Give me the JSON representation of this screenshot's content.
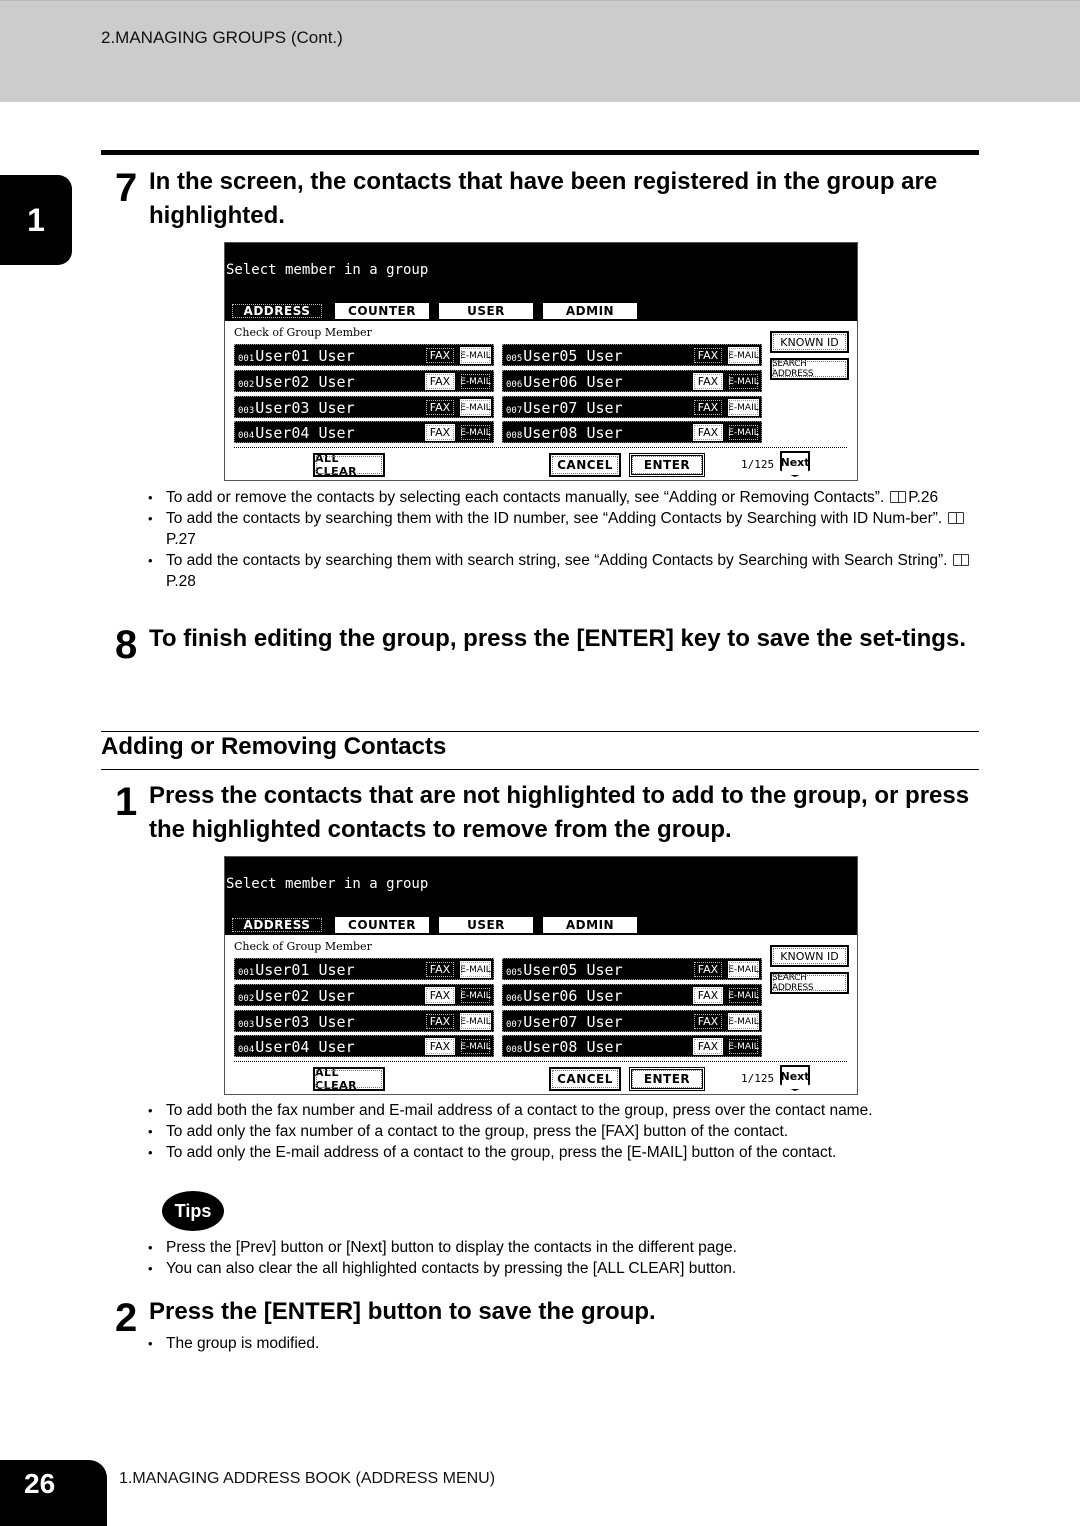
{
  "header": {
    "title": "2.MANAGING GROUPS (Cont.)"
  },
  "side_tab": {
    "chapter": "1"
  },
  "step7": {
    "number": "7",
    "text": "In the screen, the contacts that have been registered in the group are highlighted."
  },
  "screen": {
    "title": "Select member in a group",
    "tabs": [
      {
        "label": "ADDRESS",
        "active": true
      },
      {
        "label": "COUNTER",
        "active": false
      },
      {
        "label": "USER",
        "active": false
      },
      {
        "label": "ADMIN",
        "active": false
      }
    ],
    "check_label": "Check of Group Member",
    "contacts": [
      {
        "id": "001",
        "name": "User01 User",
        "fax_label": "FAX",
        "email_label": "E-MAIL",
        "fax_on": true,
        "email_on": false
      },
      {
        "id": "002",
        "name": "User02 User",
        "fax_label": "FAX",
        "email_label": "E-MAIL",
        "fax_on": false,
        "email_on": true
      },
      {
        "id": "003",
        "name": "User03 User",
        "fax_label": "FAX",
        "email_label": "E-MAIL",
        "fax_on": true,
        "email_on": false
      },
      {
        "id": "004",
        "name": "User04 User",
        "fax_label": "FAX",
        "email_label": "E-MAIL",
        "fax_on": false,
        "email_on": true
      },
      {
        "id": "005",
        "name": "User05 User",
        "fax_label": "FAX",
        "email_label": "E-MAIL",
        "fax_on": true,
        "email_on": false
      },
      {
        "id": "006",
        "name": "User06 User",
        "fax_label": "FAX",
        "email_label": "E-MAIL",
        "fax_on": false,
        "email_on": true
      },
      {
        "id": "007",
        "name": "User07 User",
        "fax_label": "FAX",
        "email_label": "E-MAIL",
        "fax_on": true,
        "email_on": false
      },
      {
        "id": "008",
        "name": "User08 User",
        "fax_label": "FAX",
        "email_label": "E-MAIL",
        "fax_on": false,
        "email_on": true
      }
    ],
    "known_id_label": "KNOWN ID",
    "search_address_label": "SEARCH ADDRESS",
    "all_clear_label": "ALL CLEAR",
    "cancel_label": "CANCEL",
    "enter_label": "ENTER",
    "page_indicator": "1/125",
    "next_label": "Next"
  },
  "step7_bullets": [
    {
      "text": "To add or remove the contacts by selecting each contacts manually, see “Adding or Removing Contacts”.",
      "ref": "P.26"
    },
    {
      "text": "To add the contacts by searching them with the ID number, see “Adding Contacts by Searching with ID Num-ber”.",
      "ref": "P.27"
    },
    {
      "text": "To add the contacts by searching them with search string, see “Adding Contacts by Searching with Search String”.",
      "ref": "P.28"
    }
  ],
  "step8": {
    "number": "8",
    "text": "To finish editing the group, press the [ENTER] key to save the set-tings."
  },
  "section": {
    "title": "Adding or Removing Contacts"
  },
  "sub_step1": {
    "number": "1",
    "text": "Press the contacts that are not highlighted to add to the group, or press the highlighted contacts to remove from the group."
  },
  "sub_step1_bullets": [
    "To add both the fax number and E-mail address of a contact to the group, press over the contact name.",
    "To add only the fax number of a contact to the group, press the [FAX] button of the contact.",
    "To add only the E-mail address of a contact to the group, press the [E-MAIL] button of the contact."
  ],
  "tips": {
    "label": "Tips",
    "items": [
      "Press the [Prev] button or [Next] button to display the contacts in the different page.",
      "You can also clear the all highlighted contacts by pressing the [ALL CLEAR] button."
    ]
  },
  "sub_step2": {
    "number": "2",
    "text": "Press the [ENTER] button to save the group.",
    "bullets": [
      "The group is modified."
    ]
  },
  "footer": {
    "page_number": "26",
    "title": "1.MANAGING ADDRESS BOOK (ADDRESS MENU)"
  }
}
